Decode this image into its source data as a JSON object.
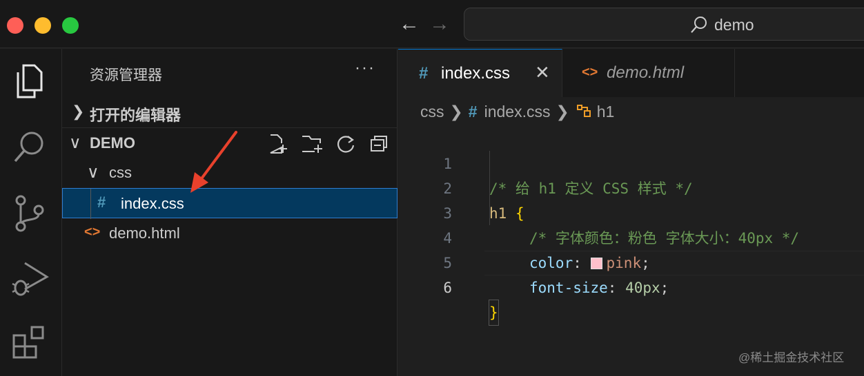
{
  "window": {
    "search_text": "demo"
  },
  "sidebar": {
    "title": "资源管理器",
    "more": "···",
    "open_editors_label": "打开的编辑器",
    "project_label": "DEMO",
    "folder_css_label": "css",
    "file_css_label": "index.css",
    "file_html_label": "demo.html"
  },
  "tabs": [
    {
      "label": "index.css",
      "icon": "css-hash-icon",
      "active": true
    },
    {
      "label": "demo.html",
      "icon": "html-brackets-icon",
      "active": false
    }
  ],
  "breadcrumbs": {
    "folder": "css",
    "file": "index.css",
    "symbol": "h1"
  },
  "code": {
    "line_numbers": [
      "1",
      "2",
      "3",
      "4",
      "5",
      "6"
    ],
    "line1_comment": "/* 给 h1 定义 CSS 样式 */",
    "line2_selector": "h1",
    "line2_brace": "{",
    "line3_comment": "/* 字体颜色：粉色 字体大小：40px */",
    "line4_prop": "color",
    "line4_value": "pink",
    "line5_prop": "font-size",
    "line5_value": "40px",
    "line6_brace": "}"
  },
  "colors": {
    "accent": "#0078d4",
    "selection": "#04395e",
    "css_icon": "#519aba",
    "html_icon": "#e37933",
    "swatch_pink": "#ffc0cb",
    "annotation_arrow": "#e8412c"
  },
  "watermark": "@稀土掘金技术社区"
}
